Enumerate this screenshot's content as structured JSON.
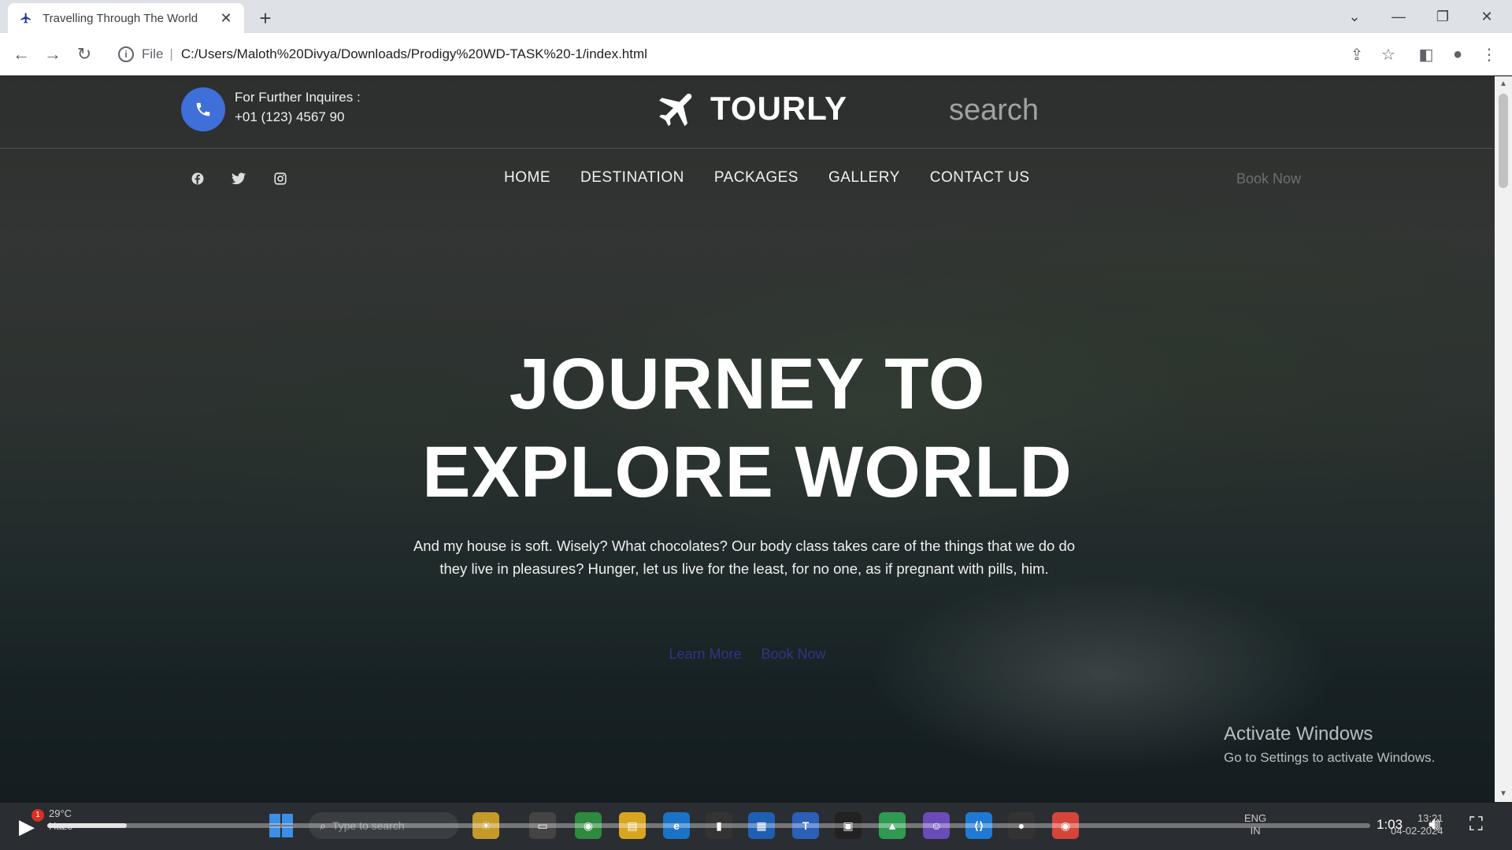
{
  "browser": {
    "tab_title": "Travelling Through The World",
    "tab_close": "✕",
    "new_tab": "+",
    "address_scheme": "File",
    "address_url": "C:/Users/Maloth%20Divya/Downloads/Prodigy%20WD-TASK%20-1/index.html"
  },
  "header": {
    "inquiry_label": "For Further Inquires :",
    "inquiry_phone": "+01 (123) 4567 90",
    "logo_text": "TOURLY",
    "search_placeholder": "search"
  },
  "nav": {
    "items": [
      {
        "label": "HOME"
      },
      {
        "label": "DESTINATION"
      },
      {
        "label": "PACKAGES"
      },
      {
        "label": "GALLERY"
      },
      {
        "label": "CONTACT US"
      }
    ],
    "book_now": "Book Now"
  },
  "social": [
    {
      "icon": "facebook-icon",
      "glyph": "f"
    },
    {
      "icon": "twitter-icon",
      "glyph": "t"
    },
    {
      "icon": "instagram-icon",
      "glyph": "▣"
    }
  ],
  "hero": {
    "title_line1": "JOURNEY TO",
    "title_line2": "EXPLORE WORLD",
    "description": "And my house is soft. Wisely? What chocolates? Our body class takes care of the things that we do do they live in pleasures? Hunger, let us live for the least, for no one, as if pregnant with pills, him.",
    "link_learn": "Learn More",
    "link_book": "Book Now"
  },
  "watermark": {
    "title": "Activate Windows",
    "subtitle": "Go to Settings to activate Windows."
  },
  "player": {
    "timestamp": "1:03",
    "progress": 0.06
  },
  "taskbar": {
    "weather_temp": "29°C",
    "weather_desc": "Haze",
    "weather_badge": "1",
    "search_placeholder": "Type to search",
    "lang_top": "ENG",
    "lang_bottom": "IN",
    "clock_time": "13:21",
    "clock_date": "04-02-2024"
  },
  "colors": {
    "accent_blue": "#3f6fd8",
    "link_purple": "#463cc8"
  }
}
